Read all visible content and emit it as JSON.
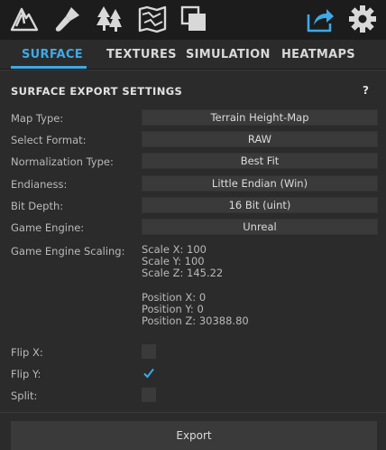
{
  "toolbar": {
    "icons": [
      "terrain-mountain-icon",
      "brush-icon",
      "forest-trees-icon",
      "map-icon",
      "layers-copy-icon",
      "export-share-icon",
      "settings-gear-icon"
    ],
    "accent_color": "#3fa9e6"
  },
  "tabs": [
    {
      "label": "SURFACE",
      "active": true
    },
    {
      "label": "TEXTURES",
      "active": false
    },
    {
      "label": "SIMULATION",
      "active": false
    },
    {
      "label": "HEATMAPS",
      "active": false
    }
  ],
  "section": {
    "title": "SURFACE EXPORT SETTINGS",
    "help": "?"
  },
  "fields": [
    {
      "label": "Map Type:",
      "value": "Terrain Height-Map"
    },
    {
      "label": "Select Format:",
      "value": "RAW"
    },
    {
      "label": "Normalization Type:",
      "value": "Best Fit"
    },
    {
      "label": "Endianess:",
      "value": "Little Endian (Win)"
    },
    {
      "label": "Bit Depth:",
      "value": "16 Bit (uint)"
    },
    {
      "label": "Game Engine:",
      "value": "Unreal"
    }
  ],
  "scaling": {
    "label": "Game Engine Scaling:",
    "scale_x": "Scale X: 100",
    "scale_y": "Scale Y: 100",
    "scale_z": "Scale Z: 145.22",
    "position_x": "Position X: 0",
    "position_y": "Position Y: 0",
    "position_z": "Position Z: 30388.80"
  },
  "checkboxes": [
    {
      "label": "Flip X:",
      "checked": false
    },
    {
      "label": "Flip Y:",
      "checked": true
    },
    {
      "label": "Split:",
      "checked": false
    }
  ],
  "export": {
    "label": "Export"
  }
}
